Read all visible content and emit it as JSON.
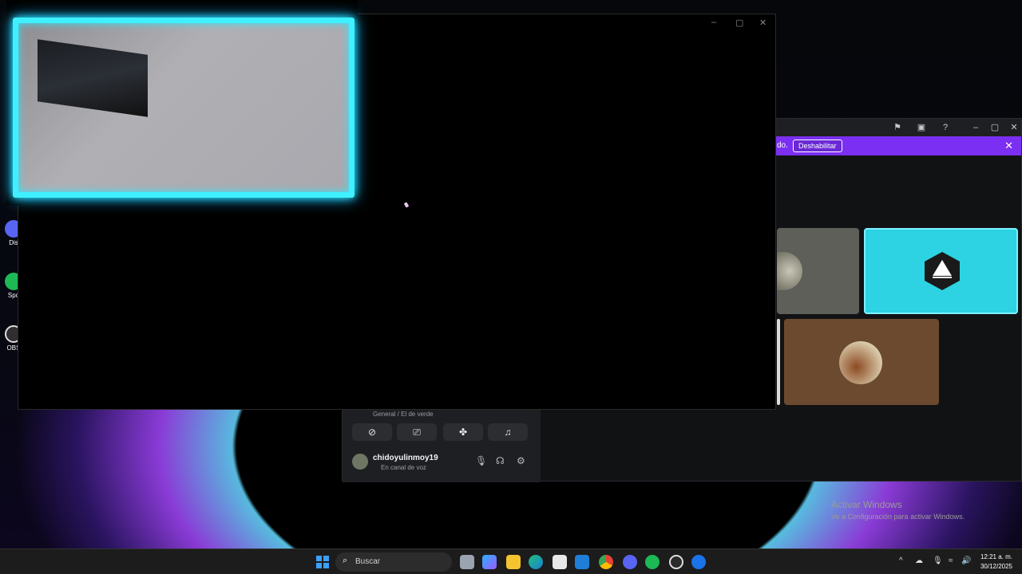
{
  "desktop": {
    "icons": [
      {
        "label": "Dis",
        "icon": "discord-icon",
        "color": "#5865f2"
      },
      {
        "label": "Spo",
        "icon": "spotify-icon",
        "color": "#1db954"
      },
      {
        "label": "OBS",
        "icon": "obs-icon",
        "color": "#302e31"
      }
    ]
  },
  "discord_window": {
    "banner_text": "do.",
    "banner_button": "Deshabilitar",
    "banner_close": "✕",
    "voice_channel": "General / El de verde",
    "user_name": "chidoyulinmoy19",
    "user_status": "En canal de voz",
    "banner_color": "#7b2ff2"
  },
  "main_window": {
    "minimize": "–",
    "maximize": "▢",
    "close": "✕"
  },
  "watermark": {
    "title": "Activar Windows",
    "subtitle": "Ve a Configuración para activar Windows."
  },
  "taskbar": {
    "search_placeholder": "Buscar",
    "time": "12:21 a. m.",
    "date": "30/12/2025"
  }
}
